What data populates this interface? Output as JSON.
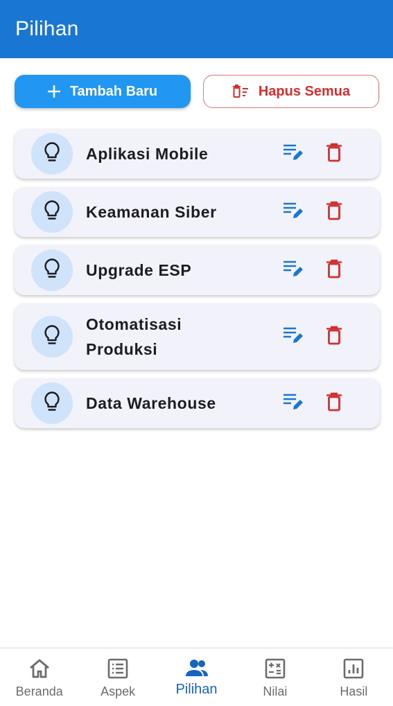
{
  "appbar": {
    "title": "Pilihan"
  },
  "actions": {
    "add_label": "Tambah Baru",
    "clear_label": "Hapus Semua"
  },
  "items": [
    {
      "title": "Aplikasi Mobile"
    },
    {
      "title": "Keamanan Siber"
    },
    {
      "title": "Upgrade ESP"
    },
    {
      "title": "Otomatisasi Produksi"
    },
    {
      "title": "Data Warehouse"
    }
  ],
  "nav": [
    {
      "label": "Beranda",
      "icon": "home-icon"
    },
    {
      "label": "Aspek",
      "icon": "list-icon"
    },
    {
      "label": "Pilihan",
      "icon": "people-icon",
      "active": true
    },
    {
      "label": "Nilai",
      "icon": "calculator-icon"
    },
    {
      "label": "Hasil",
      "icon": "chart-icon"
    }
  ],
  "colors": {
    "primary": "#1976d2",
    "accent": "#2196f3",
    "danger": "#d32f2f",
    "card": "#f1f2fa"
  }
}
